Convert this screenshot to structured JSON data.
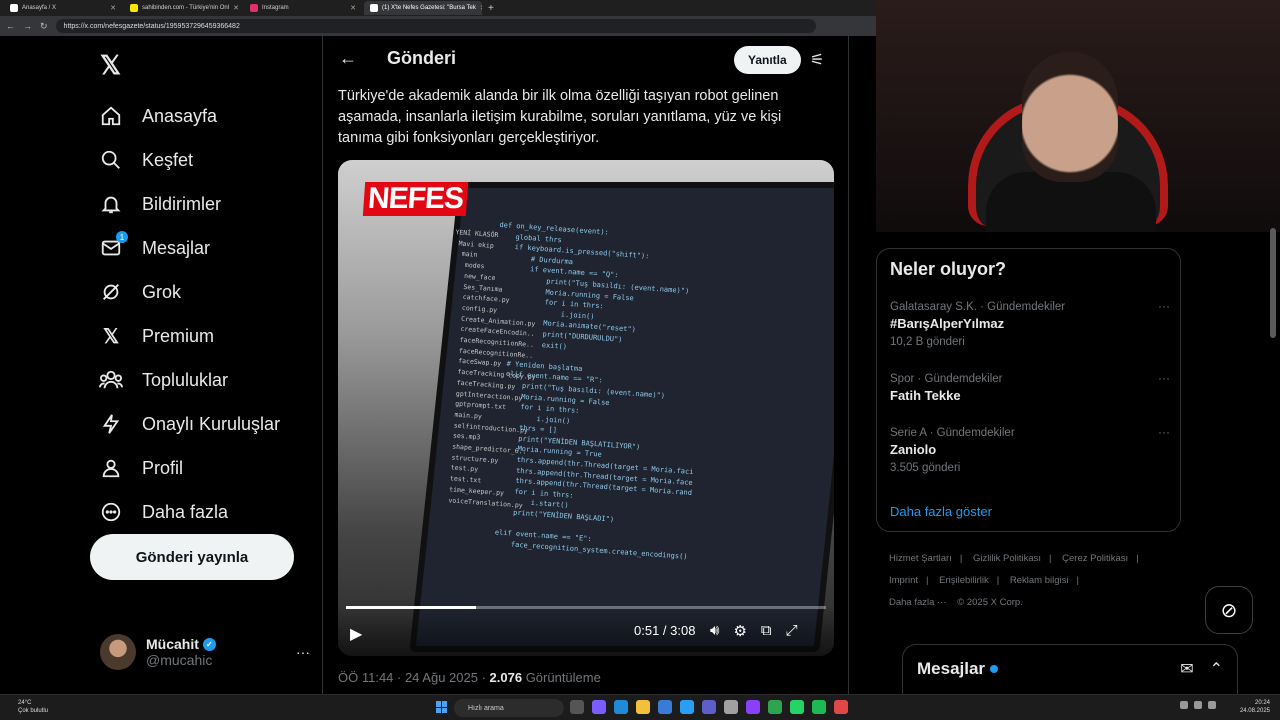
{
  "browser": {
    "tabs": [
      {
        "label": "Anasayfa / X",
        "color": "#ffffff",
        "active": false
      },
      {
        "label": "sahibinden.com - Türkiye'nin Onl",
        "color": "#ffe800",
        "active": false
      },
      {
        "label": "Instagram",
        "color": "#e1306c",
        "active": false
      },
      {
        "label": "(1) X'te Nefes Gazetesi: \"Bursa Tek",
        "color": "#ffffff",
        "active": true
      }
    ],
    "url": "https://x.com/nefesgazete/status/1959537296459366482"
  },
  "nav": {
    "items": [
      {
        "label": "Anasayfa",
        "icon": "home-icon"
      },
      {
        "label": "Keşfet",
        "icon": "search-icon"
      },
      {
        "label": "Bildirimler",
        "icon": "bell-icon"
      },
      {
        "label": "Mesajlar",
        "icon": "mail-icon",
        "badge": "1"
      },
      {
        "label": "Grok",
        "icon": "grok-icon"
      },
      {
        "label": "Premium",
        "icon": "x-logo-icon"
      },
      {
        "label": "Topluluklar",
        "icon": "people-icon"
      },
      {
        "label": "Onaylı Kuruluşlar",
        "icon": "lightning-icon"
      },
      {
        "label": "Profil",
        "icon": "person-icon"
      },
      {
        "label": "Daha fazla",
        "icon": "more-circle-icon"
      }
    ],
    "post_button": "Gönderi yayınla"
  },
  "profile": {
    "name": "Mücahit",
    "handle": "@mucahic",
    "more": "···"
  },
  "header": {
    "title": "Gönderi",
    "reply_button": "Yanıtla"
  },
  "tweet": {
    "text": "Türkiye'de akademik alanda bir ilk olma özelliği taşıyan robot gelinen aşamada, insanlarla iletişim kurabilme, soruları yanıtlama, yüz ve kişi tanıma gibi fonksiyonları gerçekleştiriyor.",
    "video": {
      "watermark": "NEFES",
      "time": "0:51 / 3:08",
      "progress": 0.27
    },
    "meta_time": "ÖÖ 11:44 · 24 Ağu 2025 · ",
    "views": "2.076",
    "views_label": " Görüntüleme"
  },
  "trends": {
    "title": "Neler oluyor?",
    "items": [
      {
        "category": "Galatasaray S.K. · Gündemdekiler",
        "name": "#BarışAlperYılmaz",
        "count": "10,2 B gönderi"
      },
      {
        "category": "Spor · Gündemdekiler",
        "name": "Fatih Tekke",
        "count": ""
      },
      {
        "category": "Serie A · Gündemdekiler",
        "name": "Zaniolo",
        "count": "3.505 gönderi"
      }
    ],
    "show_more": "Daha fazla göster"
  },
  "footer": {
    "links": [
      "Hizmet Şartları",
      "|",
      "Gizlilik Politikası",
      "|",
      "Çerez Politikası",
      "|",
      "Imprint",
      "|",
      "Erişilebilirlik",
      "|",
      "Reklam bilgisi",
      "|",
      "Daha fazla ···",
      "© 2025 X Corp."
    ]
  },
  "messages": {
    "title": "Mesajlar"
  },
  "taskbar": {
    "weather_temp": "24°C",
    "weather_desc": "Çok bulutlu",
    "search": "Hızlı arama",
    "time": "20:24",
    "date": "24.08.2025"
  }
}
